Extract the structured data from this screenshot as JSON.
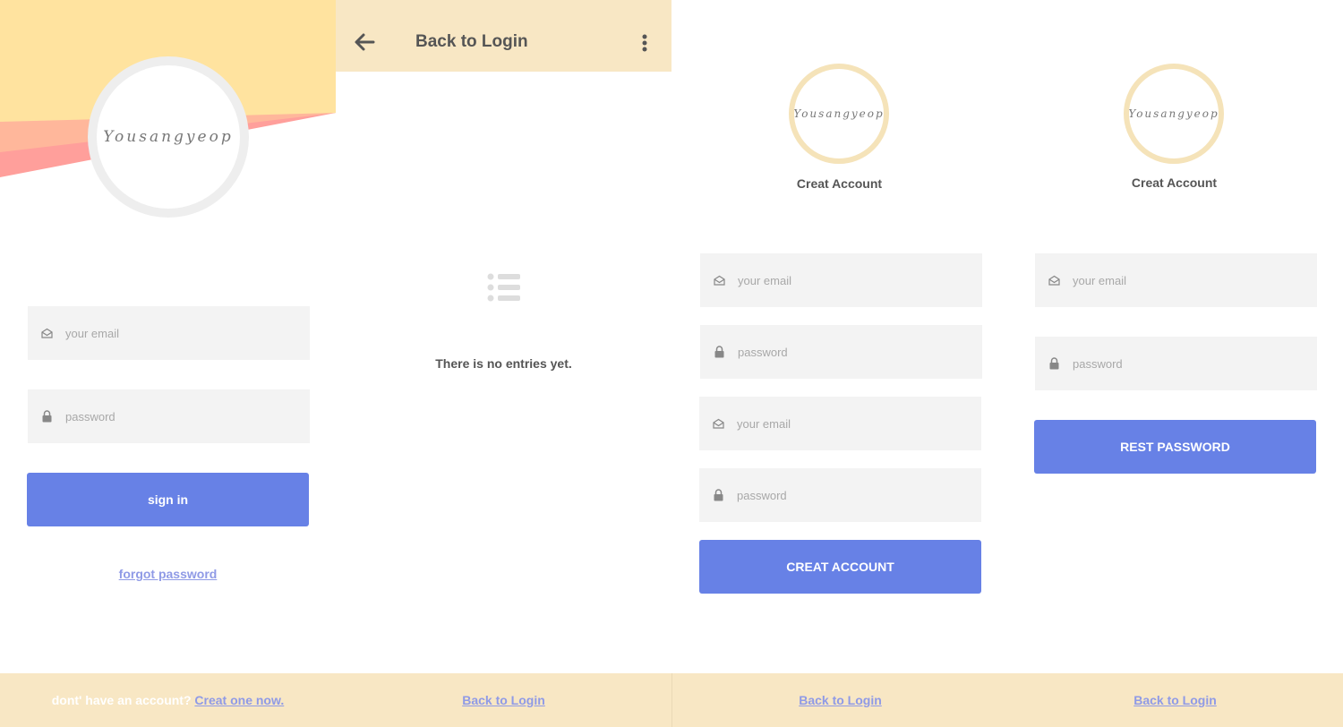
{
  "brand": {
    "logo_text": "Yousangyeop"
  },
  "login": {
    "email_placeholder": "your email",
    "password_placeholder": "password",
    "sign_in_label": "sign in",
    "forgot_label": "forgot password",
    "footer_prompt": "dont' have an account?",
    "footer_link": "Creat one now."
  },
  "empty": {
    "header_title": "Back to Login",
    "message": "There is no entries yet.",
    "footer_link": "Back to Login"
  },
  "create": {
    "title": "Creat Account",
    "email_placeholder": "your email",
    "password_placeholder": "password",
    "email2_placeholder": "your email",
    "password2_placeholder": "password",
    "button_label": "CREAT ACCOUNT",
    "footer_link": "Back to Login"
  },
  "reset": {
    "title": "Creat Account",
    "email_placeholder": "your email",
    "password_placeholder": "password",
    "button_label": "REST PASSWORD",
    "footer_link": "Back to Login"
  },
  "colors": {
    "accent": "#6781e6",
    "footer_bg": "#f8e7c4",
    "field_bg": "#f3f3f3",
    "link": "#8f9ae6",
    "header_bg": "#f8e7c4"
  }
}
